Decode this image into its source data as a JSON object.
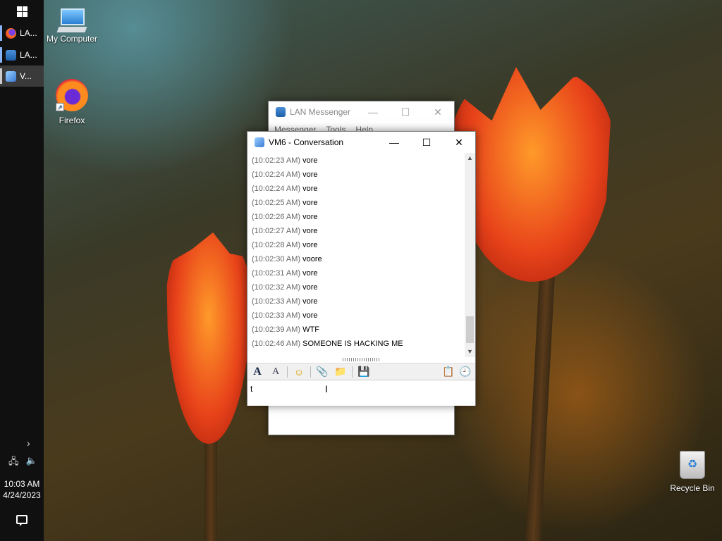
{
  "taskbar": {
    "apps": [
      {
        "label": "LA...",
        "icon": "firefox-icon"
      },
      {
        "label": "LA...",
        "icon": "lan-messenger-icon"
      },
      {
        "label": "V...",
        "icon": "vm-conversation-icon"
      }
    ],
    "clock_time": "10:03 AM",
    "clock_date": "4/24/2023"
  },
  "desktop": {
    "icons": [
      {
        "label": "My Computer"
      },
      {
        "label": "Firefox"
      },
      {
        "label": "Recycle Bin"
      }
    ]
  },
  "lan_messenger": {
    "title": "LAN Messenger",
    "menu": [
      "Messenger",
      "Tools",
      "Help"
    ]
  },
  "conversation": {
    "title": "VM6 - Conversation",
    "messages": [
      {
        "time": "(10:02:23 AM)",
        "text": "vore"
      },
      {
        "time": "(10:02:24 AM)",
        "text": "vore"
      },
      {
        "time": "(10:02:24 AM)",
        "text": "vore"
      },
      {
        "time": "(10:02:25 AM)",
        "text": "vore"
      },
      {
        "time": "(10:02:26 AM)",
        "text": "vore"
      },
      {
        "time": "(10:02:27 AM)",
        "text": "vore"
      },
      {
        "time": "(10:02:28 AM)",
        "text": "vore"
      },
      {
        "time": "(10:02:30 AM)",
        "text": "voore"
      },
      {
        "time": "(10:02:31 AM)",
        "text": "vore"
      },
      {
        "time": "(10:02:32 AM)",
        "text": "vore"
      },
      {
        "time": "(10:02:33 AM)",
        "text": "vore"
      },
      {
        "time": "(10:02:33 AM)",
        "text": "vore"
      },
      {
        "time": "(10:02:39 AM)",
        "text": "WTF"
      },
      {
        "time": "(10:02:46 AM)",
        "text": "SOMEONE IS HACKING ME"
      }
    ],
    "input_value": "t"
  }
}
